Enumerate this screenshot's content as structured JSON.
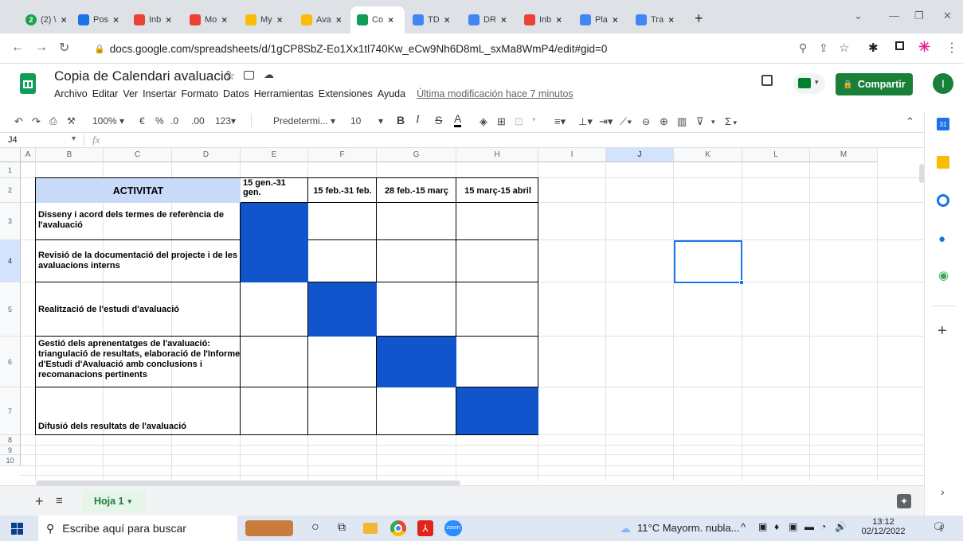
{
  "browser": {
    "tabs": [
      {
        "label": "(2) \\",
        "favicon": "whatsapp-icon",
        "color": "#1aa34a",
        "badge": "2"
      },
      {
        "label": "Pos",
        "favicon": "calendar-square-icon",
        "color": "#1a73e8"
      },
      {
        "label": "Inb",
        "favicon": "gmail-icon",
        "color": "#ea4335"
      },
      {
        "label": "Mo",
        "favicon": "gmail-icon",
        "color": "#ea4335"
      },
      {
        "label": "My",
        "favicon": "drive-icon",
        "color": "#fbbc04"
      },
      {
        "label": "Ava",
        "favicon": "drive-icon",
        "color": "#fbbc04"
      },
      {
        "label": "Co",
        "favicon": "sheets-icon",
        "color": "#0f9d58",
        "active": true
      },
      {
        "label": "TD",
        "favicon": "docs-icon",
        "color": "#4285f4"
      },
      {
        "label": "DR",
        "favicon": "docs-icon",
        "color": "#4285f4"
      },
      {
        "label": "Inb",
        "favicon": "gmail-icon",
        "color": "#ea4335"
      },
      {
        "label": "Pla",
        "favicon": "docs-icon",
        "color": "#4285f4"
      },
      {
        "label": "Tra",
        "favicon": "translate-icon",
        "color": "#4285f4"
      }
    ],
    "new_tab": "+",
    "url": "docs.google.com/spreadsheets/d/1gCP8SbZ-Eo1Xx1tl740Kw_eCw9Nh6D8mL_sxMa8WmP4/edit#gid=0"
  },
  "app": {
    "title": "Copia de Calendari avaluació",
    "menu": [
      "Archivo",
      "Editar",
      "Ver",
      "Insertar",
      "Formato",
      "Datos",
      "Herramientas",
      "Extensiones",
      "Ayuda"
    ],
    "last_edit": "Última modificación hace 7 minutos",
    "share_label": "Compartir",
    "avatar_letter": "I",
    "accent": "#188038"
  },
  "toolbar": {
    "zoom": "100%",
    "currency": "€",
    "percent": "%",
    "dec_less": ".0",
    "dec_more": ".00",
    "number_format": "123",
    "font": "Predetermi...",
    "font_size": "10",
    "bold": "B",
    "italic": "I",
    "strike": "S",
    "text_color": "A",
    "sigma": "Σ"
  },
  "formula_bar": {
    "cell_ref": "J4",
    "fx": "fx",
    "value": ""
  },
  "grid": {
    "columns": [
      "A",
      "B",
      "C",
      "D",
      "E",
      "F",
      "G",
      "H",
      "I",
      "J",
      "K",
      "L",
      "M"
    ],
    "selected_column": "J",
    "rows": [
      "1",
      "2",
      "3",
      "4",
      "5",
      "6",
      "7",
      "8",
      "9",
      "10"
    ],
    "header_row": {
      "activitat": "ACTIVITAT",
      "periods": [
        "15 gen.-31 gen.",
        "15 feb.-31 feb.",
        "28 feb.-15 març",
        "15 març-15 abril"
      ]
    },
    "activities": [
      "Disseny i acord dels termes de referència de l'avaluació",
      "Revisió de la documentació del projecte i de les avaluacions interns",
      "Realització de l'estudi d'avaluació",
      "Gestió dels aprenentatges de l'avaluació: triangulació de resultats, elaboració de l'Informe d'Estudi d'Avaluació amb conclusions i recomanacions pertinents",
      "Difusió dels resultats de l'avaluació"
    ],
    "schedule_color": "#1155cc",
    "header_fill": "#c9daf8"
  },
  "sheets": {
    "active": "Hoja 1"
  },
  "taskbar": {
    "search_placeholder": "Escribe aquí para buscar",
    "weather": "11°C  Mayorm. nubla...",
    "time": "13:12",
    "date": "02/12/2022",
    "notif_count": "4"
  }
}
